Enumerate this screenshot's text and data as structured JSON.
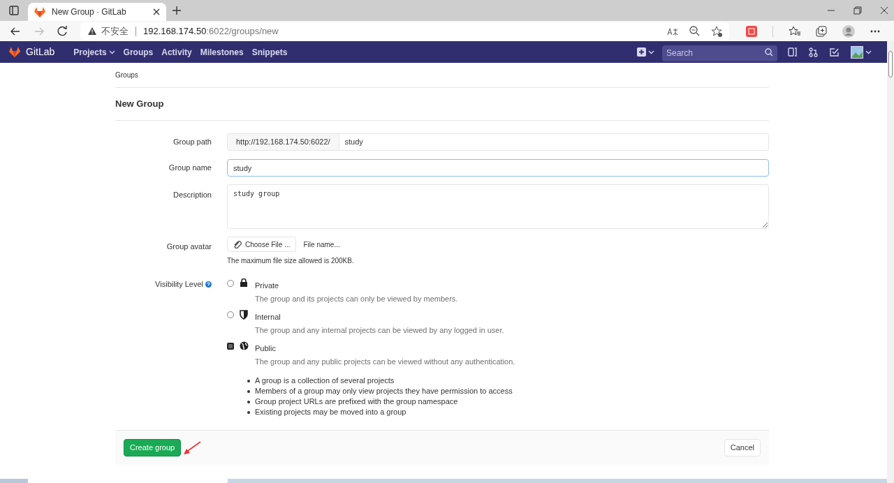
{
  "browser": {
    "tab_title": "New Group · GitLab",
    "security": "不安全",
    "url_host": "192.168.174.50",
    "url_rest": ":6022/groups/new"
  },
  "navbar": {
    "brand": "GitLab",
    "links": [
      {
        "label": "Projects",
        "dropdown": true
      },
      {
        "label": "Groups",
        "dropdown": false
      },
      {
        "label": "Activity",
        "dropdown": false
      },
      {
        "label": "Milestones",
        "dropdown": false
      },
      {
        "label": "Snippets",
        "dropdown": false
      }
    ],
    "search": {
      "placeholder": "Search"
    }
  },
  "breadcrumb": "Groups",
  "page_title": "New Group",
  "form": {
    "group_path": {
      "label": "Group path",
      "prefix": "http://192.168.174.50:6022/",
      "value": "study"
    },
    "group_name": {
      "label": "Group name",
      "value": "study"
    },
    "description": {
      "label": "Description",
      "value": "study group"
    },
    "group_avatar": {
      "label": "Group avatar",
      "button": "Choose File ...",
      "file_name": "File name...",
      "help": "The maximum file size allowed is 200KB."
    },
    "visibility": {
      "label": "Visibility Level",
      "options": [
        {
          "kind": "lock",
          "title": "Private",
          "description": "The group and its projects can only be viewed by members.",
          "selected": false
        },
        {
          "kind": "shield",
          "title": "Internal",
          "description": "The group and any internal projects can be viewed by any logged in user.",
          "selected": false
        },
        {
          "kind": "globe",
          "title": "Public",
          "description": "The group and any public projects can be viewed without any authentication.",
          "selected": true
        }
      ]
    },
    "notes": [
      "A group is a collection of several projects",
      "Members of a group may only view projects they have permission to access",
      "Group project URLs are prefixed with the group namespace",
      "Existing projects may be moved into a group"
    ]
  },
  "actions": {
    "submit": "Create group",
    "cancel": "Cancel"
  }
}
